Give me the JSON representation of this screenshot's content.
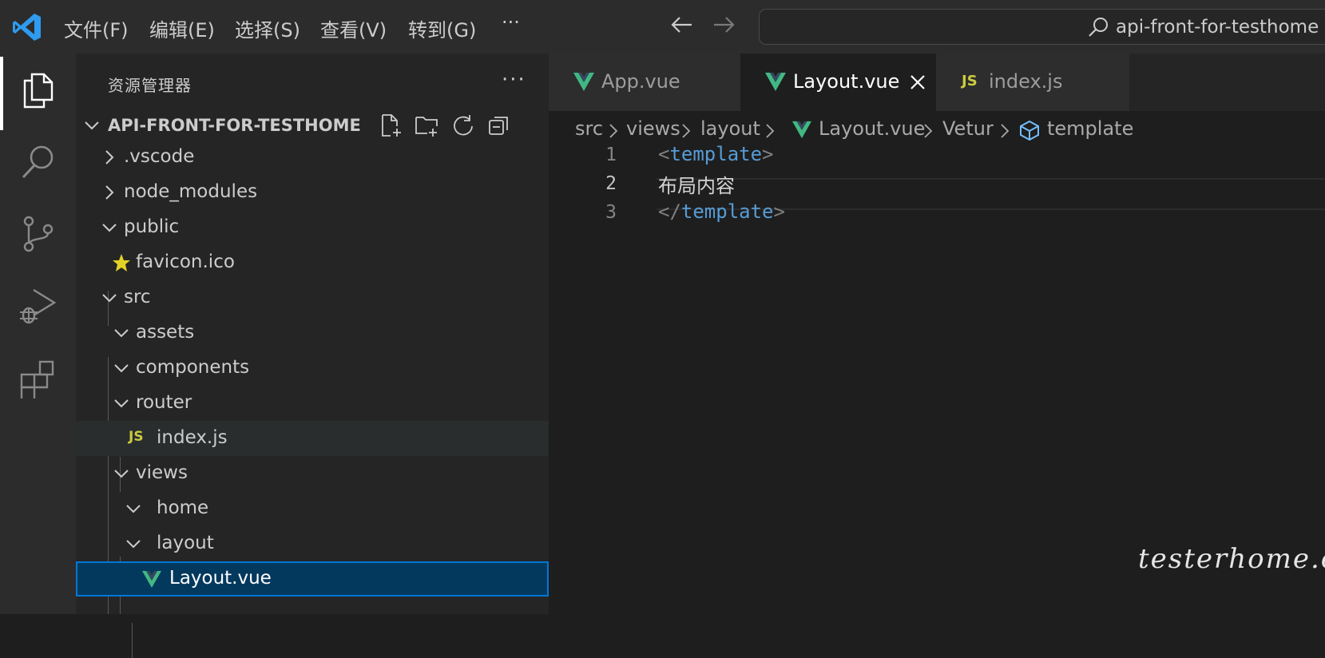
{
  "titlebar": {
    "menu": [
      "文件(F)",
      "编辑(E)",
      "选择(S)",
      "查看(V)",
      "转到(G)",
      "···"
    ],
    "search_text": "api-front-for-testhome",
    "icons": [
      "vscode-logo",
      "arrow-left-icon",
      "arrow-right-icon",
      "search-icon"
    ]
  },
  "activitybar": {
    "items": [
      "explorer-icon",
      "search-icon",
      "source-control-icon",
      "run-debug-icon",
      "extensions-icon"
    ]
  },
  "sidebar": {
    "title": "资源管理器",
    "more": "···",
    "project": "API-FRONT-FOR-TESTHOME",
    "tree": [
      {
        "label": ".vscode",
        "type": "folder",
        "expanded": false
      },
      {
        "label": "node_modules",
        "type": "folder",
        "expanded": false
      },
      {
        "label": "public",
        "type": "folder",
        "expanded": true
      },
      {
        "label": "favicon.ico",
        "type": "file"
      },
      {
        "label": "src",
        "type": "folder",
        "expanded": true
      },
      {
        "label": "assets",
        "type": "folder",
        "expanded": true
      },
      {
        "label": "components",
        "type": "folder",
        "expanded": true
      },
      {
        "label": "router",
        "type": "folder",
        "expanded": true
      },
      {
        "label": "index.js",
        "type": "file"
      },
      {
        "label": "views",
        "type": "folder",
        "expanded": true
      },
      {
        "label": "home",
        "type": "folder",
        "expanded": true
      },
      {
        "label": "layout",
        "type": "folder",
        "expanded": true
      },
      {
        "label": "Layout.vue",
        "type": "file",
        "selected": true
      }
    ],
    "js_badge": "JS"
  },
  "tabs": [
    {
      "label": "App.vue",
      "active": false
    },
    {
      "label": "Layout.vue",
      "active": true
    },
    {
      "label": "index.js",
      "active": false
    }
  ],
  "breadcrumb": [
    "src",
    "views",
    "layout",
    "Layout.vue",
    "Vetur",
    "template"
  ],
  "editor": {
    "lines": [
      {
        "num": "1",
        "open": "<",
        "tag": "template",
        "close": ">"
      },
      {
        "num": "2",
        "text": "布局内容"
      },
      {
        "num": "3",
        "open": "</",
        "tag": "template",
        "close": ">"
      }
    ],
    "current_line": 2
  },
  "watermark": "testerhome.com",
  "colors": {
    "accent": "#0078d4",
    "vue_green": "#41b883",
    "js_yellow": "#cbcb41",
    "tag_blue": "#569cd6",
    "selection": "#04395e"
  }
}
